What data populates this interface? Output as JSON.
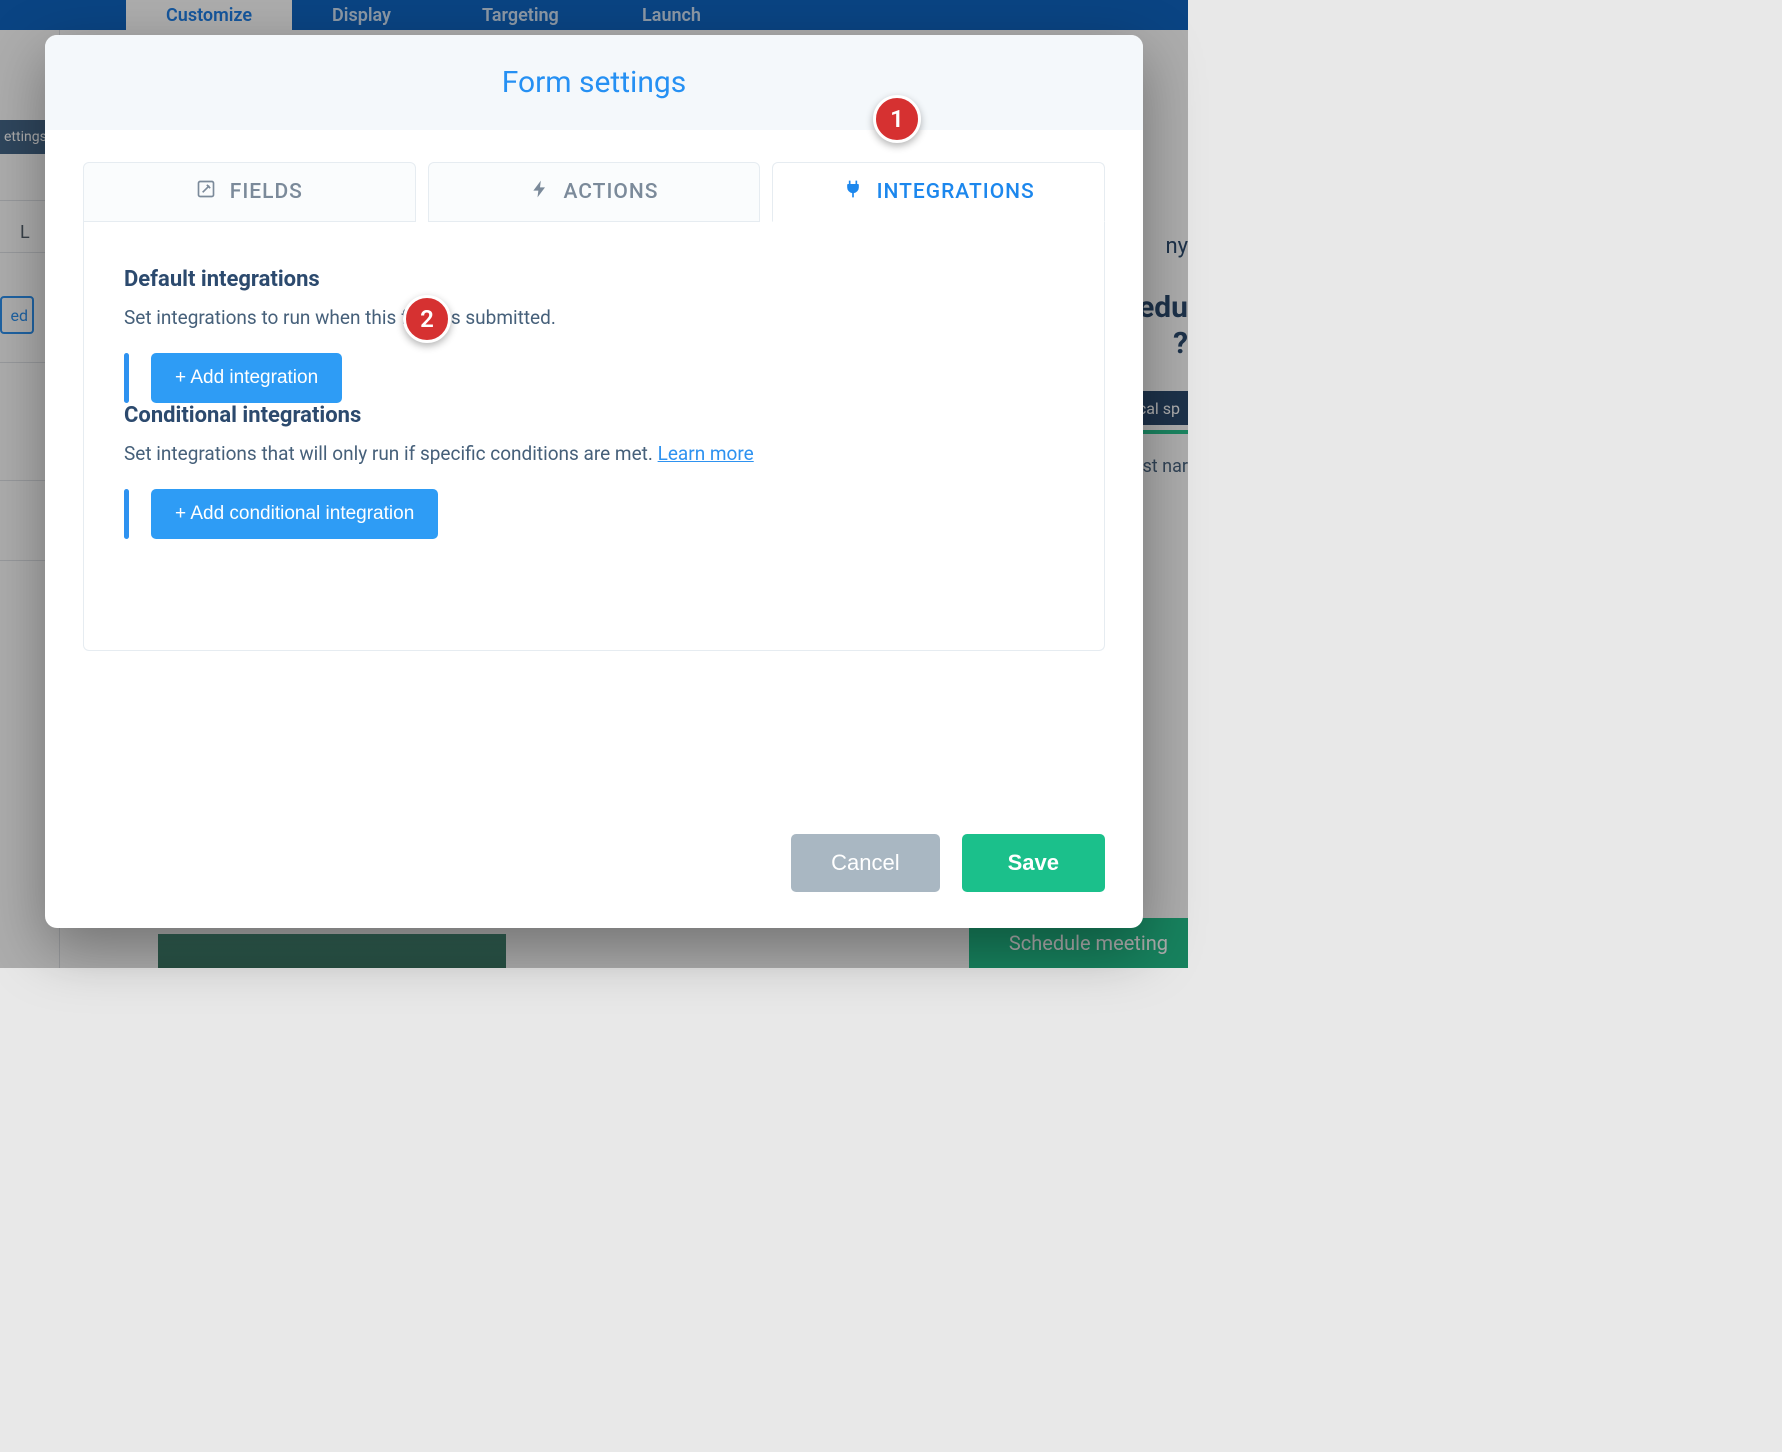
{
  "bg": {
    "top_tabs": [
      "Customize",
      "Display",
      "Targeting",
      "Launch"
    ],
    "settings": "ettings",
    "l": "L",
    "ed": "ed",
    "right_ny": "ny",
    "right_edu": "edu",
    "right_q": "?",
    "right_strip": "cal sp",
    "right_stnan": "st nar",
    "schedule": "Schedule meeting"
  },
  "modal": {
    "title": "Form settings",
    "tabs": {
      "fields": "FIELDS",
      "actions": "ACTIONS",
      "integrations": "INTEGRATIONS"
    },
    "default": {
      "title": "Default integrations",
      "desc": "Set integrations to run when this form is submitted.",
      "btn": "+ Add integration"
    },
    "conditional": {
      "title": "Conditional integrations",
      "desc_pre": "Set integrations that will only run if specific conditions are met. ",
      "learn_more": "Learn more",
      "btn": "+ Add conditional integration"
    },
    "cancel": "Cancel",
    "save": "Save"
  },
  "callouts": {
    "one": "1",
    "two": "2"
  }
}
